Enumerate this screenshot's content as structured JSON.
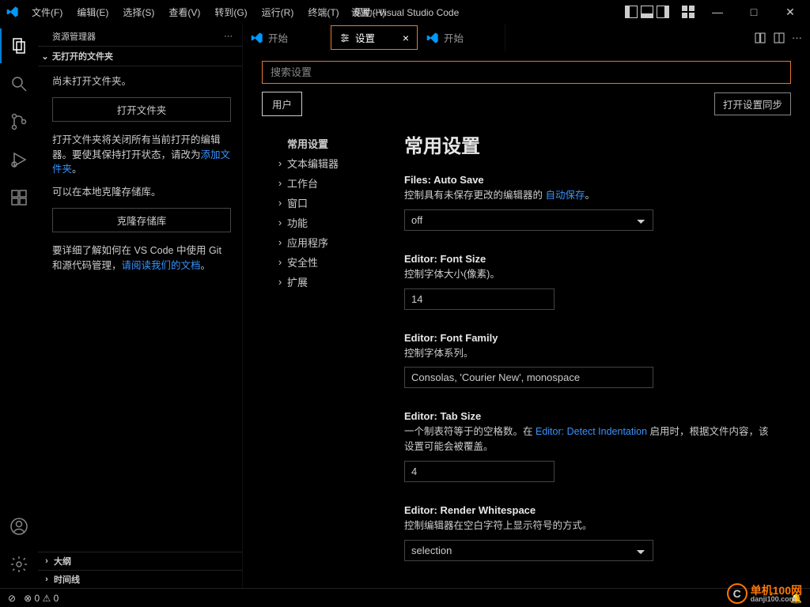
{
  "titlebar": {
    "app_title": "设置 - Visual Studio Code",
    "menu": {
      "file": "文件(F)",
      "edit": "编辑(E)",
      "select": "选择(S)",
      "view": "查看(V)",
      "go": "转到(G)",
      "run": "运行(R)",
      "terminal": "终端(T)",
      "help": "帮助(H)"
    },
    "win": {
      "min": "—",
      "max": "□",
      "close": "✕"
    }
  },
  "sidebar": {
    "title": "资源管理器",
    "more": "···",
    "section": "无打开的文件夹",
    "no_folder_open": "尚未打开文件夹。",
    "open_folder_btn": "打开文件夹",
    "open_folder_desc_1": "打开文件夹将关闭所有当前打开的编辑器。要使其保持打开状态，请改为",
    "open_folder_link": "添加文件夹",
    "open_folder_desc_2": "。",
    "clone_desc": "可以在本地克隆存储库。",
    "clone_btn": "克隆存储库",
    "learn_1": "要详细了解如何在 VS Code 中使用 Git 和源代码管理，",
    "learn_link": "请阅读我们的文档",
    "learn_2": "。",
    "outline": "大纲",
    "timeline": "时间线"
  },
  "tabs": {
    "start": "开始",
    "settings": "设置",
    "start2": "开始"
  },
  "settings": {
    "search_placeholder": "搜索设置",
    "user_tab": "用户",
    "sync_btn": "打开设置同步",
    "nav": {
      "common": "常用设置",
      "text_editor": "文本编辑器",
      "workbench": "工作台",
      "window": "窗口",
      "features": "功能",
      "application": "应用程序",
      "security": "安全性",
      "extensions": "扩展"
    },
    "heading": "常用设置",
    "autosave": {
      "label": "Files: Auto Save",
      "desc_1": "控制具有未保存更改的编辑器的 ",
      "desc_link": "自动保存",
      "desc_2": "。",
      "value": "off"
    },
    "fontsize": {
      "label": "Editor: Font Size",
      "desc": "控制字体大小(像素)。",
      "value": "14"
    },
    "fontfamily": {
      "label": "Editor: Font Family",
      "desc": "控制字体系列。",
      "value": "Consolas, 'Courier New', monospace"
    },
    "tabsize": {
      "label": "Editor: Tab Size",
      "desc_1": "一个制表符等于的空格数。在 ",
      "desc_link": "Editor: Detect Indentation",
      "desc_2": " 启用时，根据文件内容，该设置可能会被覆盖。",
      "value": "4"
    },
    "whitespace": {
      "label": "Editor: Render Whitespace",
      "desc": "控制编辑器在空白字符上显示符号的方式。",
      "value": "selection"
    }
  },
  "statusbar": {
    "errors": "0",
    "warnings": "0",
    "bell": "🔔"
  },
  "watermark": {
    "text": "单机100网",
    "sub": "danji100.com"
  }
}
